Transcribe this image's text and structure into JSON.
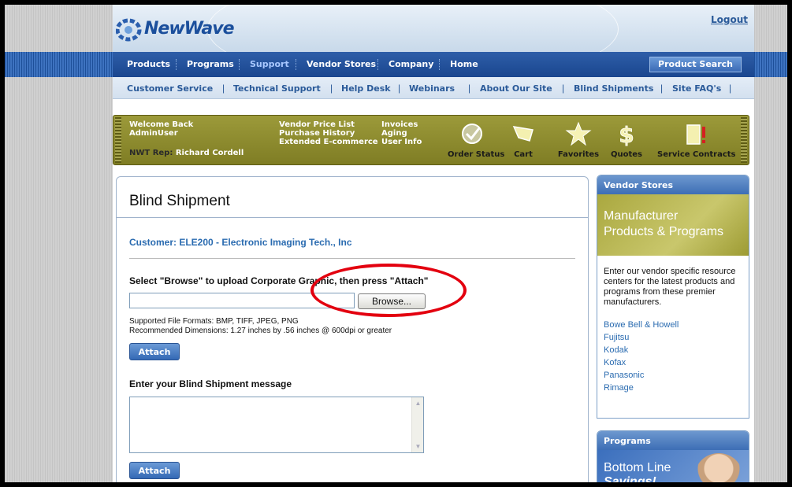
{
  "header": {
    "logo_text": "NewWave",
    "logout": "Logout"
  },
  "main_nav": {
    "items": [
      "Products",
      "Programs",
      "Support",
      "Vendor Stores",
      "Company",
      "Home"
    ],
    "active": "Support",
    "product_search": "Product Search"
  },
  "sub_nav": {
    "items": [
      "Customer Service",
      "Technical Support",
      "Help Desk",
      "Webinars",
      "About Our Site",
      "Blind Shipments",
      "Site FAQ's"
    ]
  },
  "account_bar": {
    "welcome": "Welcome Back",
    "user": "AdminUser",
    "rep_label": "NWT Rep:",
    "rep_name": "Richard Cordell",
    "links_col1": [
      "Vendor Price List",
      "Purchase History",
      "Extended E-commerce"
    ],
    "links_col2": [
      "Invoices",
      "Aging",
      "User Info"
    ],
    "tools": [
      {
        "label": "Order Status",
        "icon": "check-circle-icon"
      },
      {
        "label": "Cart",
        "icon": "cart-icon"
      },
      {
        "label": "Favorites",
        "icon": "star-icon"
      },
      {
        "label": "Quotes",
        "icon": "dollar-icon"
      },
      {
        "label": "Service Contracts",
        "icon": "document-alert-icon"
      }
    ]
  },
  "panel": {
    "title": "Blind Shipment",
    "customer": "Customer:  ELE200 - Electronic Imaging Tech., Inc",
    "upload_prompt": "Select \"Browse\" to upload Corporate Graphic, then press \"Attach\"",
    "file_value": "",
    "browse_label": "Browse...",
    "formats": "Supported File Formats: BMP, TIFF, JPEG, PNG",
    "dimensions": "Recommended Dimensions: 1.27 inches by .56 inches @ 600dpi or greater",
    "attach_label": "Attach",
    "message_label": "Enter your Blind Shipment message",
    "message_value": "",
    "attach2_label": "Attach"
  },
  "vendor_stores": {
    "heading": "Vendor Stores",
    "banner_line1": "Manufacturer",
    "banner_line2": "Products & Programs",
    "description": "Enter our vendor specific resource centers for the latest products and programs from these premier manufacturers.",
    "vendors": [
      "Bowe Bell & Howell",
      "Fujitsu",
      "Kodak",
      "Kofax",
      "Panasonic",
      "Rimage"
    ]
  },
  "programs": {
    "heading": "Programs",
    "banner_line1": "Bottom Line",
    "banner_line2": "Savings!"
  },
  "colors": {
    "nav_blue": "#1a468f",
    "olive": "#8f8d2e",
    "link_blue": "#2a6bb0",
    "highlight_red": "#e3000f"
  }
}
